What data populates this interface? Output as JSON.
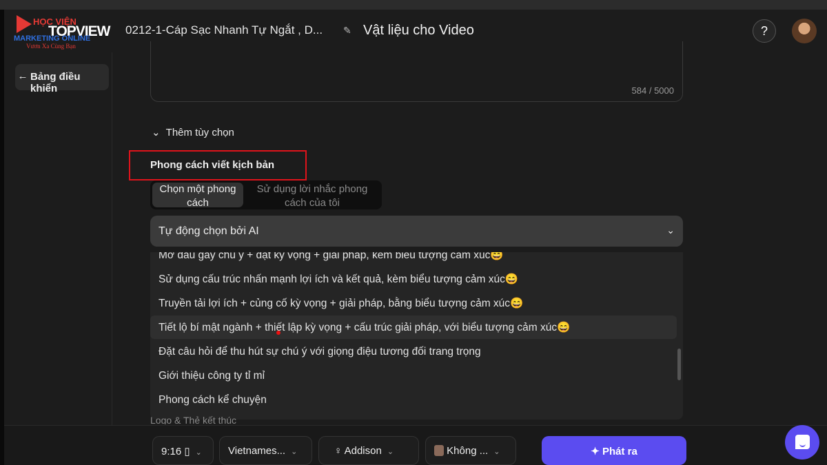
{
  "logo": {
    "line1": "HỌC VIỆN",
    "line2": "TOPVIEW",
    "line3": "MARKETING ONLINE",
    "line4": "Vươn Xa Cùng Bạn"
  },
  "header": {
    "project": "0212-1-Cáp Sạc Nhanh Tự Ngắt , D...",
    "title": "Vật liệu cho Video",
    "help": "?",
    "edit_icon": "edit-icon"
  },
  "sidebar": {
    "back_label": "Bảng điều khiển"
  },
  "textarea": {
    "count": "584 / 5000"
  },
  "more_options": "Thêm tùy chọn",
  "style_label": "Phong cách viết kịch bản",
  "segment": {
    "option_a": "Chọn một phong cách",
    "option_b": "Sử dụng lời nhắc phong cách của tôi"
  },
  "select": {
    "value": "Tự động chọn bởi AI"
  },
  "options": [
    "Mở đầu gây chú ý + đặt kỳ vọng + giải pháp, kèm biểu tượng cảm xúc😄",
    "Sử dụng cấu trúc nhấn mạnh lợi ích và kết quả, kèm biểu tượng cảm xúc😄",
    "Truyền tải lợi ích + củng cố kỳ vọng + giải pháp, bằng biểu tượng cảm xúc😄",
    "Tiết lộ bí mật ngành + thiết lập kỳ vọng + cấu trúc giải pháp, với biểu tượng cảm xúc😄",
    "Đặt câu hỏi để thu hút sự chú ý với giọng điệu tương đối trang trọng",
    "Giới thiệu công ty tỉ mỉ",
    "Phong cách kể chuyện"
  ],
  "cut_section": "Logo & Thẻ kết thúc",
  "bottom": {
    "ratio": "9:16",
    "language": "Vietnames...",
    "voice": "Addison",
    "avatar": "Không ...",
    "generate": "Phát ra"
  },
  "colors": {
    "accent": "#5b4cf0",
    "highlight_box": "#e0131b"
  }
}
